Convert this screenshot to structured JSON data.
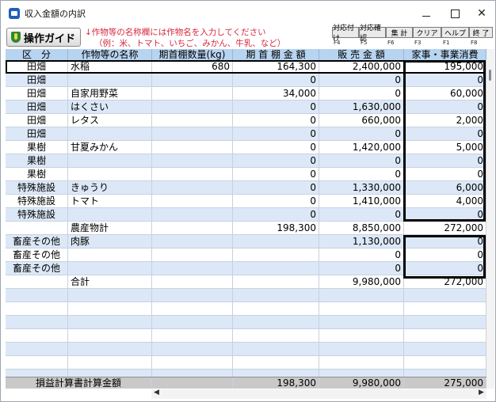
{
  "window": {
    "title": "収入金額の内訳"
  },
  "toolbar": {
    "guide_label": "操作ガイド",
    "hint_line1": "↓作物等の名称欄には作物名を入力してください",
    "hint_line2": "（例：米、トマト、いちご、みかん、牛乳、など）",
    "fkeys": [
      {
        "label": "対応付け",
        "code": "F4"
      },
      {
        "label": "対応確認",
        "code": "F5"
      },
      {
        "label": "集 計",
        "code": "F6"
      },
      {
        "label": "クリア",
        "code": "F3"
      },
      {
        "label": "ヘルプ",
        "code": "F1"
      },
      {
        "label": "終 了",
        "code": "F8"
      }
    ]
  },
  "table": {
    "headers": [
      "区　分",
      "作物等の名称",
      "期首棚数量(kg)",
      "期 首 棚 金 額",
      "販 売 金 額",
      "家事・事業消費"
    ],
    "rows": [
      {
        "kubun": "田畑",
        "name": "水稲",
        "qty": "680",
        "amt": "164,300",
        "sales": "2,400,000",
        "home": "195,000"
      },
      {
        "kubun": "田畑",
        "name": "",
        "qty": "",
        "amt": "0",
        "sales": "0",
        "home": "0"
      },
      {
        "kubun": "田畑",
        "name": "自家用野菜",
        "qty": "",
        "amt": "34,000",
        "sales": "0",
        "home": "60,000"
      },
      {
        "kubun": "田畑",
        "name": "はくさい",
        "qty": "",
        "amt": "0",
        "sales": "1,630,000",
        "home": "0"
      },
      {
        "kubun": "田畑",
        "name": "レタス",
        "qty": "",
        "amt": "0",
        "sales": "660,000",
        "home": "2,000"
      },
      {
        "kubun": "田畑",
        "name": "",
        "qty": "",
        "amt": "0",
        "sales": "0",
        "home": "0"
      },
      {
        "kubun": "果樹",
        "name": "甘夏みかん",
        "qty": "",
        "amt": "0",
        "sales": "1,420,000",
        "home": "5,000"
      },
      {
        "kubun": "果樹",
        "name": "",
        "qty": "",
        "amt": "0",
        "sales": "0",
        "home": "0"
      },
      {
        "kubun": "果樹",
        "name": "",
        "qty": "",
        "amt": "0",
        "sales": "0",
        "home": "0"
      },
      {
        "kubun": "特殊施設",
        "name": "きゅうり",
        "qty": "",
        "amt": "0",
        "sales": "1,330,000",
        "home": "6,000"
      },
      {
        "kubun": "特殊施設",
        "name": "トマト",
        "qty": "",
        "amt": "0",
        "sales": "1,410,000",
        "home": "4,000"
      },
      {
        "kubun": "特殊施設",
        "name": "",
        "qty": "",
        "amt": "0",
        "sales": "0",
        "home": "0"
      },
      {
        "kubun": "",
        "name": "農産物計",
        "qty": "",
        "amt": "198,300",
        "sales": "8,850,000",
        "home": "272,000"
      },
      {
        "kubun": "畜産その他",
        "name": "肉豚",
        "qty": "",
        "amt": "",
        "sales": "1,130,000",
        "home": "0"
      },
      {
        "kubun": "畜産その他",
        "name": "",
        "qty": "",
        "amt": "",
        "sales": "0",
        "home": "0"
      },
      {
        "kubun": "畜産その他",
        "name": "",
        "qty": "",
        "amt": "",
        "sales": "0",
        "home": "0"
      },
      {
        "kubun": "",
        "name": "合計",
        "qty": "",
        "amt": "",
        "sales": "9,980,000",
        "home": "272,000"
      },
      {
        "kubun": "",
        "name": "",
        "qty": "",
        "amt": "",
        "sales": "",
        "home": ""
      },
      {
        "kubun": "",
        "name": "",
        "qty": "",
        "amt": "",
        "sales": "",
        "home": ""
      },
      {
        "kubun": "",
        "name": "",
        "qty": "",
        "amt": "",
        "sales": "",
        "home": ""
      },
      {
        "kubun": "",
        "name": "",
        "qty": "",
        "amt": "",
        "sales": "",
        "home": ""
      },
      {
        "kubun": "",
        "name": "",
        "qty": "",
        "amt": "",
        "sales": "",
        "home": ""
      },
      {
        "kubun": "",
        "name": "",
        "qty": "",
        "amt": "",
        "sales": "",
        "home": ""
      },
      {
        "kubun": "",
        "name": "",
        "qty": "",
        "amt": "",
        "sales": "",
        "home": ""
      }
    ],
    "footer": {
      "label": "損益計算書計算金額",
      "amt": "198,300",
      "sales": "9,980,000",
      "home": "275,000"
    }
  },
  "colors": {
    "header_bg": "#b7d4f0",
    "alt_row_bg": "#dce8f7",
    "hint_text": "#d7263d"
  }
}
